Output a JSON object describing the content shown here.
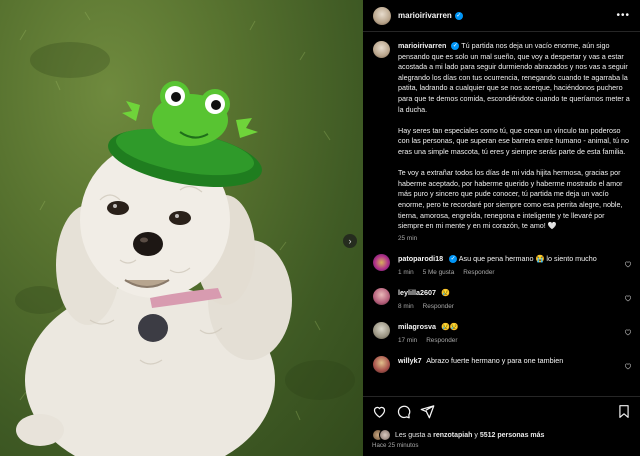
{
  "post": {
    "username": "marioirivarren",
    "caption_paragraphs": [
      "Tú partida nos deja un vacío enorme, aún sigo pensando que es solo un mal sueño, que voy a despertar y vas a estar acostada a mi lado para seguir durmiendo abrazados y nos vas a seguir alegrando los días con tus ocurrencia, renegando cuando te agarraba la patita, ladrando a cualquier que se nos acerque, haciéndonos puchero para que te demos comida, escondiéndote cuando te queríamos meter a la ducha.",
      "Hay seres tan especiales como tú, que crean un vínculo tan poderoso con las personas, que superan ese barrera entre humano - animal, tú no eras una simple mascota, tú eres y siempre serás parte de esta familia.",
      "Te voy a extrañar todos los días de mi vida hijita hermosa, gracias por haberme aceptado, por haberme querido y haberme mostrado el amor más puro y sincero que pude conocer, tú partida me deja un vacío enorme, pero te recordaré por siempre como esa perrita alegre, noble, tierna, amorosa, engreída, renegona e inteligente y te llevaré por siempre en mi mente y en mi corazón, te amo! 🤍"
    ],
    "caption_time": "25 min"
  },
  "comments": [
    {
      "username": "patoparodi18",
      "text": "Asu que pena hermano 😭 lo siento mucho",
      "time": "1 min",
      "likes": "5 Me gusta",
      "reply": "Responder"
    },
    {
      "username": "leylilla2607",
      "text": "😢",
      "time": "8 min",
      "likes": "",
      "reply": "Responder"
    },
    {
      "username": "milagrosva",
      "text": "😢😢",
      "time": "17 min",
      "likes": "",
      "reply": "Responder"
    },
    {
      "username": "willyk7",
      "text": "Abrazo fuerte hermano y para one tambien",
      "time": "",
      "likes": "",
      "reply": ""
    }
  ],
  "footer": {
    "likes_prefix": "Les gusta a ",
    "likes_user": "renzotapiah",
    "likes_mid": " y ",
    "likes_count": "5512 personas más",
    "time": "Hace 25 minutos"
  },
  "icons": {
    "header_more": "more-icon",
    "like": "heart-icon",
    "comment": "comment-icon",
    "share": "share-icon",
    "save": "bookmark-icon",
    "carousel": "chevron-right-icon"
  },
  "colors": {
    "background": "#000000",
    "verified": "#0095f6",
    "muted_text": "#a8a8a8",
    "hat_green": "#2f9a2a"
  }
}
